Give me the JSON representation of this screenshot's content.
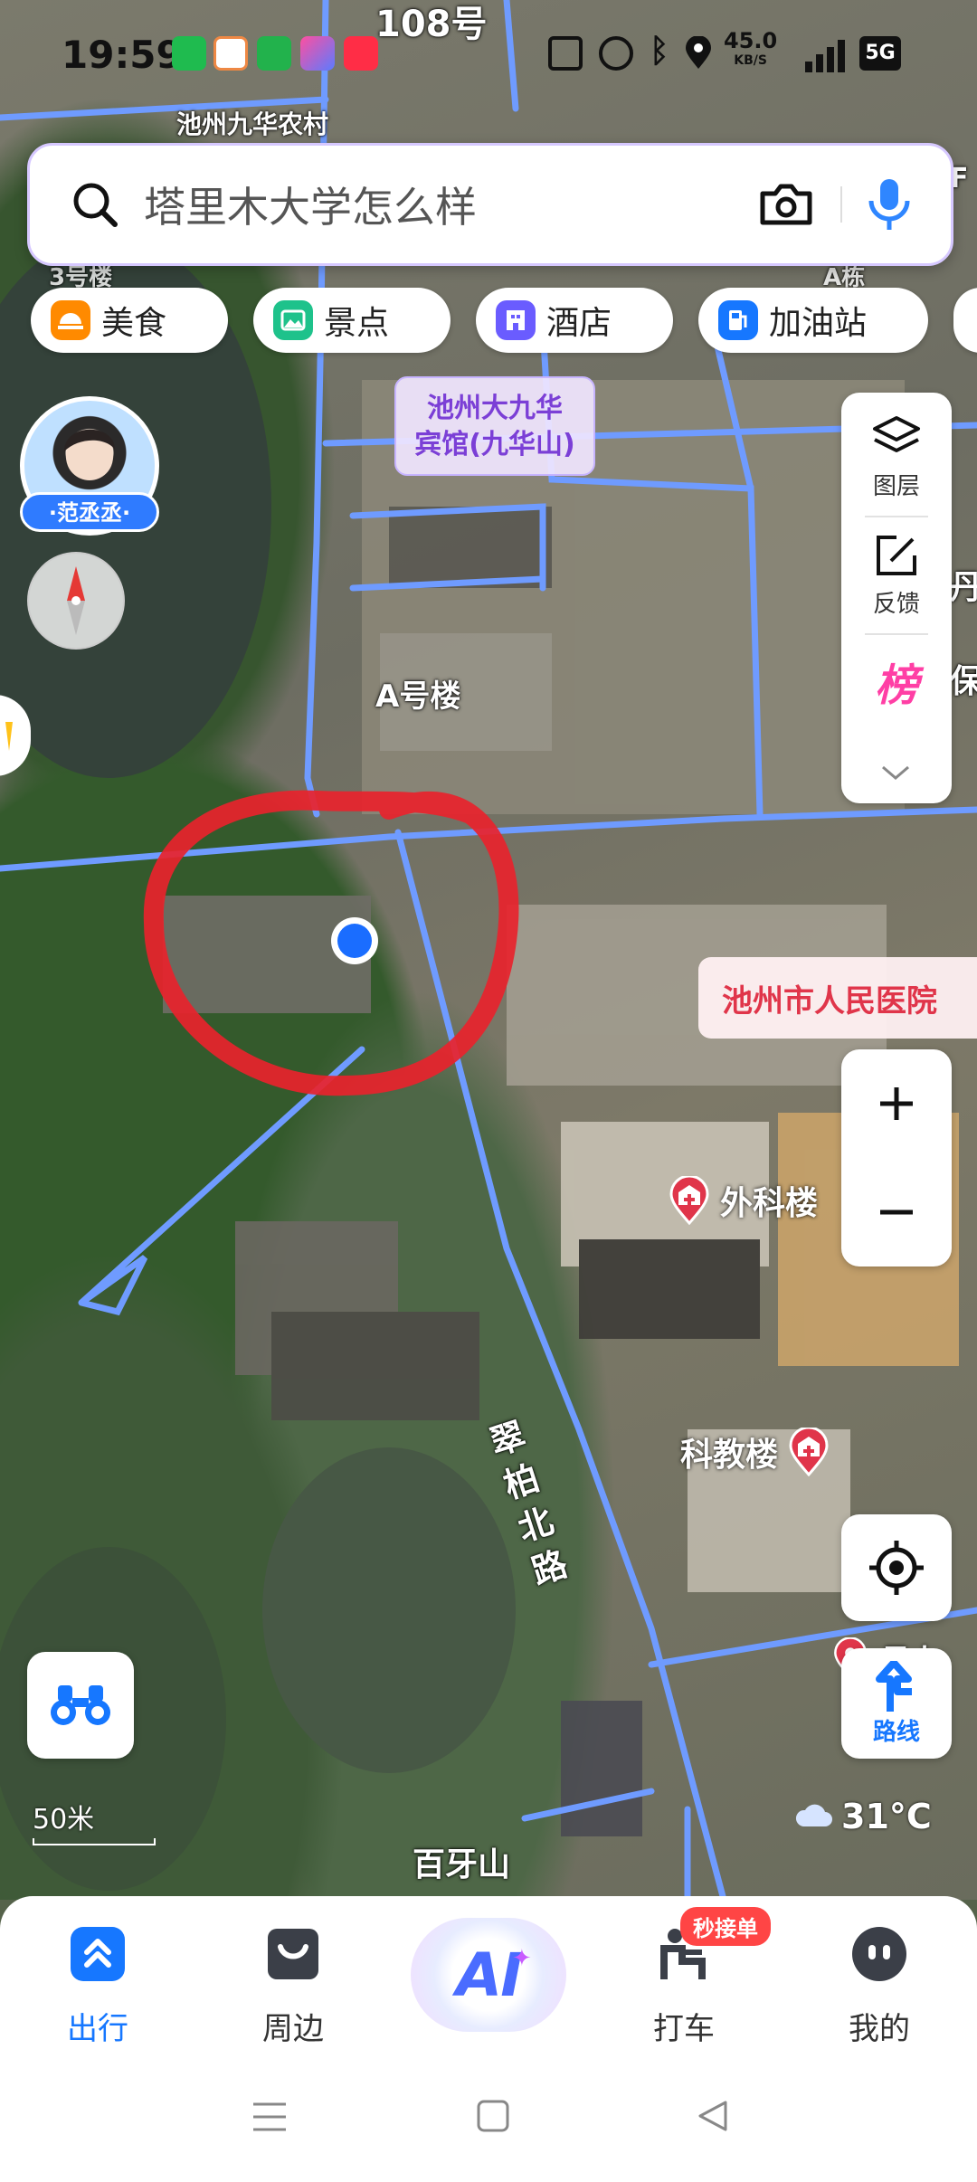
{
  "status_bar": {
    "time": "19:59",
    "network_speed": "45.0",
    "network_speed_unit": "KB/S",
    "signal_label": "5G",
    "battery": "5G"
  },
  "search": {
    "placeholder": "塔里木大学怎么样"
  },
  "categories": [
    {
      "label": "美食",
      "icon": "food-icon",
      "color": "#ff8a00"
    },
    {
      "label": "景点",
      "icon": "scenic-icon",
      "color": "#1ec28b"
    },
    {
      "label": "酒店",
      "icon": "hotel-icon",
      "color": "#6a5cff"
    },
    {
      "label": "加油站",
      "icon": "gas-station-icon",
      "color": "#1677ff"
    }
  ],
  "avatar": {
    "name": "·范丞丞·"
  },
  "tools": {
    "layers": "图层",
    "feedback": "反馈",
    "ranking_icon": "榜"
  },
  "map": {
    "labels": {
      "top_village": "池州九华农村",
      "top_number": "108号",
      "building_a": "A号楼",
      "building_3": "3号楼",
      "road": "翠柏北路",
      "mountain": "百牙山",
      "right_edge_1": "丹",
      "right_edge_2": "保",
      "right_edge_3": "A栋",
      "right_edge_4": "F"
    },
    "hotel_label": "池州大九华\n宾馆(九华山)",
    "hotel_line1": "池州大九华",
    "hotel_line2": "宾馆(九华山)",
    "hospital_label": "池州市人民医院",
    "pois": [
      {
        "label": "外科楼",
        "icon": "hospital-pin-icon"
      },
      {
        "label": "科教楼",
        "icon": "hospital-pin-icon"
      },
      {
        "label": "星大",
        "icon": "location-pin-icon"
      }
    ],
    "scale": "50米",
    "weather_temp": "31°C"
  },
  "route_button": {
    "label": "路线"
  },
  "bottom_nav": [
    {
      "label": "出行",
      "active": true,
      "icon": "travel-icon"
    },
    {
      "label": "周边",
      "active": false,
      "icon": "nearby-icon"
    },
    {
      "label": "AI",
      "active": false,
      "icon": "ai-icon"
    },
    {
      "label": "打车",
      "active": false,
      "icon": "taxi-icon",
      "badge": "秒接单"
    },
    {
      "label": "我的",
      "active": false,
      "icon": "profile-icon"
    }
  ],
  "colors": {
    "accent": "#1677ff",
    "road": "#6f9bff",
    "hospital": "#e0354a",
    "annotation": "#e8232c"
  }
}
